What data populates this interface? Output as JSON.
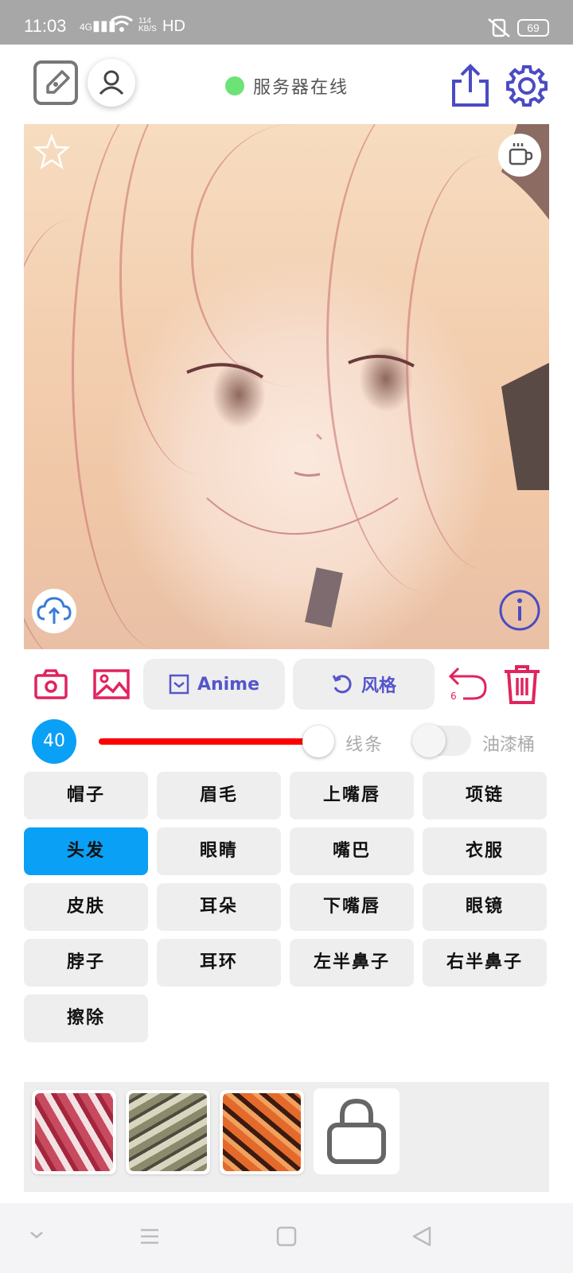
{
  "status_bar": {
    "time": "11:03",
    "signal": "4G",
    "speed_value": "114",
    "speed_unit": "KB/S",
    "hd": "HD",
    "battery": "69"
  },
  "header": {
    "server_status": "服务器在线",
    "server_status_color": "#6de276"
  },
  "toolbar": {
    "anime_label": "Anime",
    "style_label": "风格",
    "undo_count": "6",
    "accent_color": "#e0245e",
    "pill_text_color": "#5555cc"
  },
  "brush": {
    "size": "40",
    "level": 0.75,
    "line_label": "线条",
    "bucket_label": "油漆桶",
    "slider_color": "#ff0000",
    "badge_color": "#0aa0f5"
  },
  "parts": [
    {
      "label": "帽子",
      "selected": false
    },
    {
      "label": "眉毛",
      "selected": false
    },
    {
      "label": "上嘴唇",
      "selected": false
    },
    {
      "label": "项链",
      "selected": false
    },
    {
      "label": "头发",
      "selected": true
    },
    {
      "label": "眼睛",
      "selected": false
    },
    {
      "label": "嘴巴",
      "selected": false
    },
    {
      "label": "衣服",
      "selected": false
    },
    {
      "label": "皮肤",
      "selected": false
    },
    {
      "label": "耳朵",
      "selected": false
    },
    {
      "label": "下嘴唇",
      "selected": false
    },
    {
      "label": "眼镜",
      "selected": false
    },
    {
      "label": "脖子",
      "selected": false
    },
    {
      "label": "耳环",
      "selected": false
    },
    {
      "label": "左半鼻子",
      "selected": false
    },
    {
      "label": "右半鼻子",
      "selected": false
    },
    {
      "label": "擦除",
      "selected": false
    }
  ],
  "icons": {
    "top_left": [
      "edit-icon",
      "user-icon"
    ],
    "top_right": [
      "share-icon",
      "settings-icon"
    ],
    "canvas": [
      "star-icon",
      "coffee-icon",
      "cloud-upload-icon",
      "info-icon"
    ],
    "toolbar": [
      "camera-icon",
      "image-icon",
      "checkbox-icon",
      "rotate-icon",
      "undo-icon",
      "trash-icon"
    ],
    "nav": [
      "chevron-down-icon",
      "menu-icon",
      "home-square-icon",
      "back-triangle-icon"
    ]
  }
}
